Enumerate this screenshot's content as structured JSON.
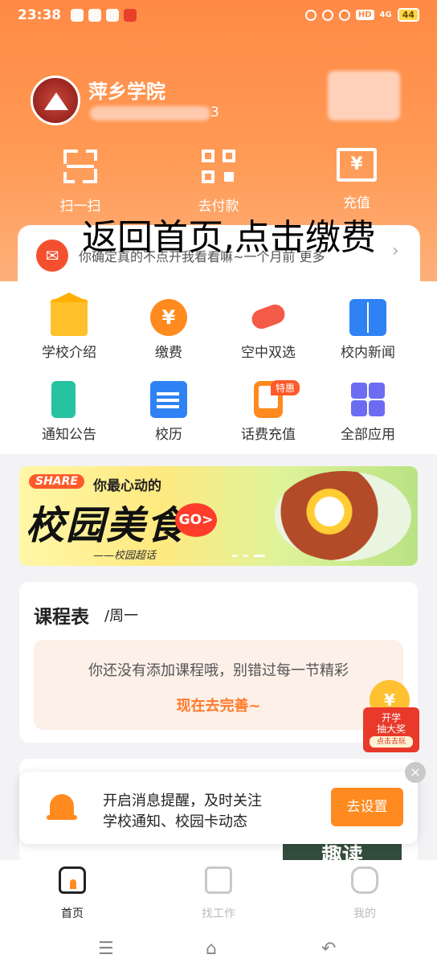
{
  "status_bar": {
    "time": "23:38",
    "battery": "44",
    "net_tag": "HD",
    "signal": "4G"
  },
  "school": {
    "name": "萍乡学院",
    "id_suffix": "3"
  },
  "quick_actions": [
    {
      "label": "扫一扫",
      "icon": "scan-icon"
    },
    {
      "label": "去付款",
      "icon": "qr-code-icon"
    },
    {
      "label": "充值",
      "icon": "recharge-icon",
      "glyph": "¥"
    }
  ],
  "notice": {
    "text": "你确定真的不点开我看看嘛~一个月前  更多",
    "arrow": "›",
    "icon": "megaphone-icon"
  },
  "overlay_instruction": "返回首页,点击缴费",
  "apps": [
    {
      "label": "学校介绍",
      "icon": "school-building-icon"
    },
    {
      "label": "缴费",
      "icon": "payment-icon",
      "glyph": "¥"
    },
    {
      "label": "空中双选",
      "icon": "handshake-icon"
    },
    {
      "label": "校内新闻",
      "icon": "newspaper-icon"
    },
    {
      "label": "通知公告",
      "icon": "announcement-icon"
    },
    {
      "label": "校历",
      "icon": "calendar-icon"
    },
    {
      "label": "话费充值",
      "icon": "phone-recharge-icon",
      "badge": "特惠"
    },
    {
      "label": "全部应用",
      "icon": "all-apps-icon"
    }
  ],
  "banner": {
    "share": "SHARE",
    "subtitle": "你最心动的",
    "title": "校园美食",
    "go": "GO>",
    "author": "——校园超话"
  },
  "schedule": {
    "title": "课程表",
    "day": "/周一",
    "empty_message": "你还没有添加课程哦，别错过每一节精彩",
    "link": "现在去完善~"
  },
  "lottery": {
    "line1": "开学",
    "line2": "抽大奖",
    "button": "点击去玩"
  },
  "peek_text": "趣读",
  "notify_prompt": {
    "line1": "开启消息提醒，及时关注",
    "line2": "学校通知、校园卡动态",
    "button": "去设置",
    "close": "×"
  },
  "bottom_nav": [
    {
      "label": "首页",
      "active": true
    },
    {
      "label": "找工作",
      "active": false
    },
    {
      "label": "我的",
      "active": false
    }
  ],
  "colors": {
    "brand_orange": "#ff8a45",
    "accent": "#ff7a2a"
  }
}
